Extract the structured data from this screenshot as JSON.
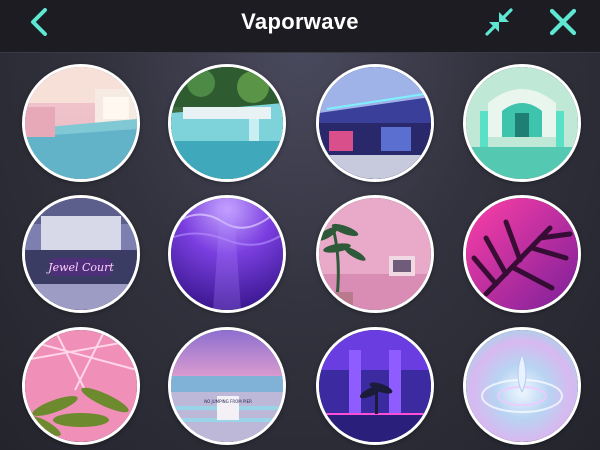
{
  "header": {
    "title": "Vaporwave",
    "accent_color": "#5ee7d2",
    "back_icon": "chevron-left-icon",
    "compress_icon": "compress-arrows-icon",
    "close_icon": "close-x-icon"
  },
  "gallery": {
    "items": [
      {
        "name": "pink-pool-room"
      },
      {
        "name": "atrium-fountain"
      },
      {
        "name": "neon-mall"
      },
      {
        "name": "teal-tile-arch"
      },
      {
        "name": "lobby-neon-sign",
        "sign_text": "Jewel Court"
      },
      {
        "name": "purple-underwater"
      },
      {
        "name": "pink-palm-room"
      },
      {
        "name": "magenta-palm-leaves"
      },
      {
        "name": "pink-skylight-palms"
      },
      {
        "name": "beach-pier-sunset",
        "sign_text": "NO JUMPING FROM PIER"
      },
      {
        "name": "purple-neon-hall"
      },
      {
        "name": "iridescent-water-drop"
      }
    ]
  }
}
